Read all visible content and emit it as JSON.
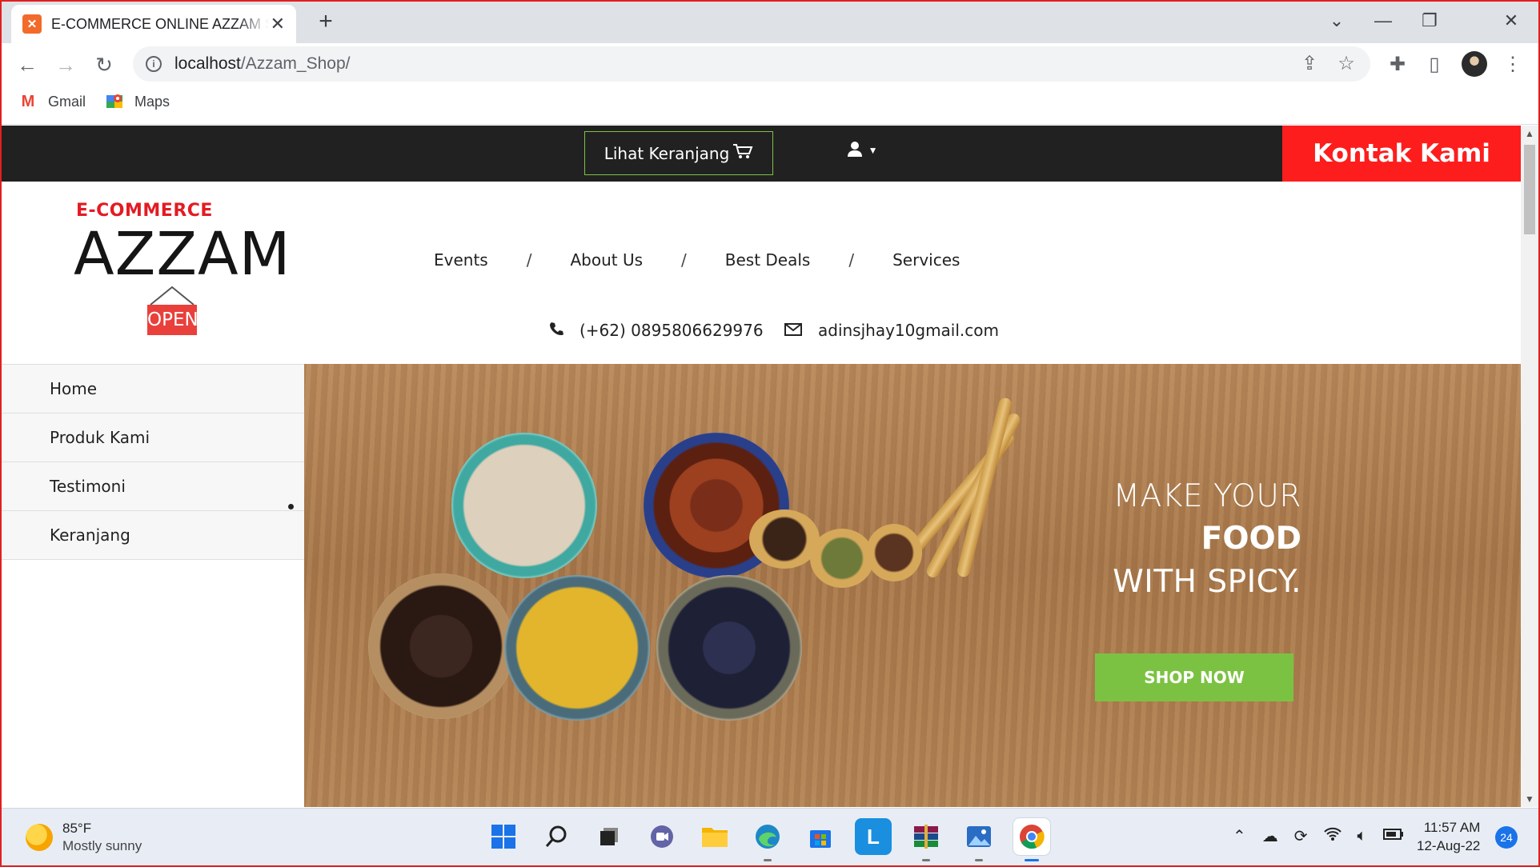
{
  "browser": {
    "tab_title": "E-COMMERCE ONLINE AZZAM SHOP",
    "url_host": "localhost",
    "url_path": "/Azzam_Shop/",
    "bookmarks": [
      {
        "label": "Gmail",
        "icon": "gmail-icon"
      },
      {
        "label": "Maps",
        "icon": "maps-icon"
      }
    ]
  },
  "site": {
    "topbar": {
      "cart_label": "Lihat Keranjang",
      "contact_label": "Kontak Kami"
    },
    "logo": {
      "tagline": "E-COMMERCE",
      "name": "AZZAM",
      "sign": "OPEN"
    },
    "nav": [
      "Events",
      "About Us",
      "Best Deals",
      "Services"
    ],
    "nav_separator": "/",
    "contact": {
      "phone": "(+62) 0895806629976",
      "email": "adinsjhay10gmail.com"
    },
    "sidebar": [
      "Home",
      "Produk Kami",
      "Testimoni",
      "Keranjang"
    ],
    "hero": {
      "line1": "MAKE YOUR",
      "line2": "FOOD",
      "line3": "WITH SPICY.",
      "button": "SHOP NOW"
    },
    "colors": {
      "accent_red": "#fd1d1d",
      "accent_green": "#7cc242",
      "topbar": "#212121"
    }
  },
  "taskbar": {
    "weather_temp": "85°F",
    "weather_desc": "Mostly sunny",
    "time": "11:57 AM",
    "date": "12-Aug-22",
    "notifications": "24"
  }
}
